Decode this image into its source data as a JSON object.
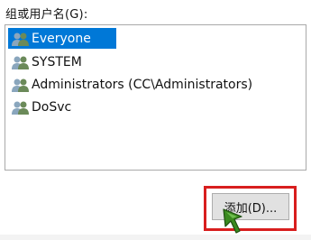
{
  "group_label": "组或用户名(G):",
  "principals": [
    {
      "name": "Everyone",
      "icon": "users-group-icon",
      "selected": true
    },
    {
      "name": "SYSTEM",
      "icon": "users-group-icon",
      "selected": false
    },
    {
      "name": "Administrators (CC\\Administrators)",
      "icon": "users-group-icon",
      "selected": false
    },
    {
      "name": "DoSvc",
      "icon": "users-group-icon",
      "selected": false
    }
  ],
  "add_button_label": "添加(D)...",
  "colors": {
    "selection": "#0078d7",
    "highlight_box": "#d81e1e",
    "cursor": "#3a8a1f"
  }
}
